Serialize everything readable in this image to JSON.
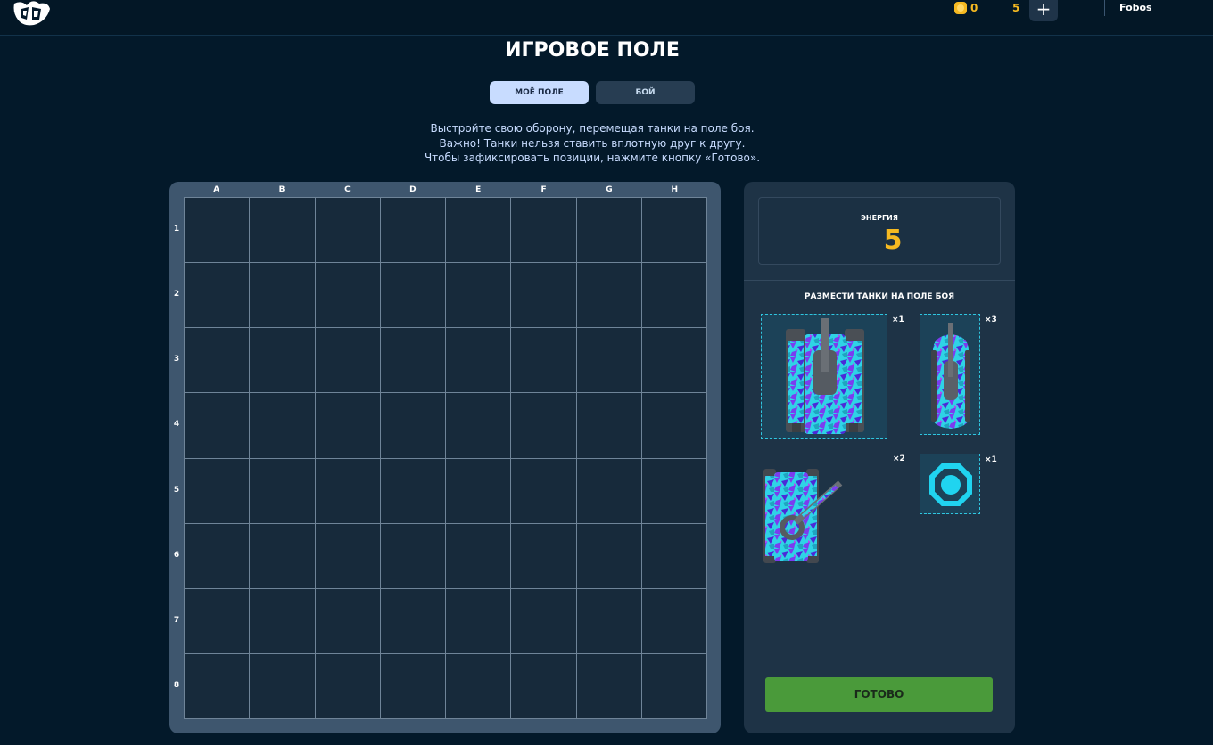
{
  "header": {
    "logo": "logo-icon",
    "coins": "0",
    "energy": "5",
    "plus": "+",
    "username": "Fobos"
  },
  "page_title": "ИГРОВОЕ ПОЛЕ",
  "tabs": [
    {
      "label": "МОЁ ПОЛЕ",
      "active": true
    },
    {
      "label": "БОЙ",
      "active": false
    }
  ],
  "instructions": [
    "Выстройте свою оборону, перемещая танки на поле боя.",
    "Важно! Танки нельзя ставить вплотную друг к другу.",
    "Чтобы зафиксировать позиции, нажмите кнопку «Готово»."
  ],
  "board": {
    "columns": [
      "A",
      "B",
      "C",
      "D",
      "E",
      "F",
      "G",
      "H"
    ],
    "rows": [
      "1",
      "2",
      "3",
      "4",
      "5",
      "6",
      "7",
      "8"
    ]
  },
  "panel": {
    "energy_label": "ЭНЕРГИЯ",
    "energy_value": "5",
    "place_title": "РАЗМЕСТИ ТАНКИ НА ПОЛЕ БОЯ",
    "units": [
      {
        "name": "heavy-tank",
        "qty": "×1"
      },
      {
        "name": "light-tank",
        "qty": "×3"
      },
      {
        "name": "medium-tank",
        "qty": "×2"
      },
      {
        "name": "shield-mine",
        "qty": "×1"
      }
    ],
    "ready_label": "ГОТОВО"
  },
  "colors": {
    "background": "#03192a",
    "accent_gold": "#f5b921",
    "ready_green": "#4a9a3a",
    "slot_border": "#2fc6e0",
    "camo_cyan": "#2fd3e6",
    "camo_purple": "#7b3cf0"
  }
}
